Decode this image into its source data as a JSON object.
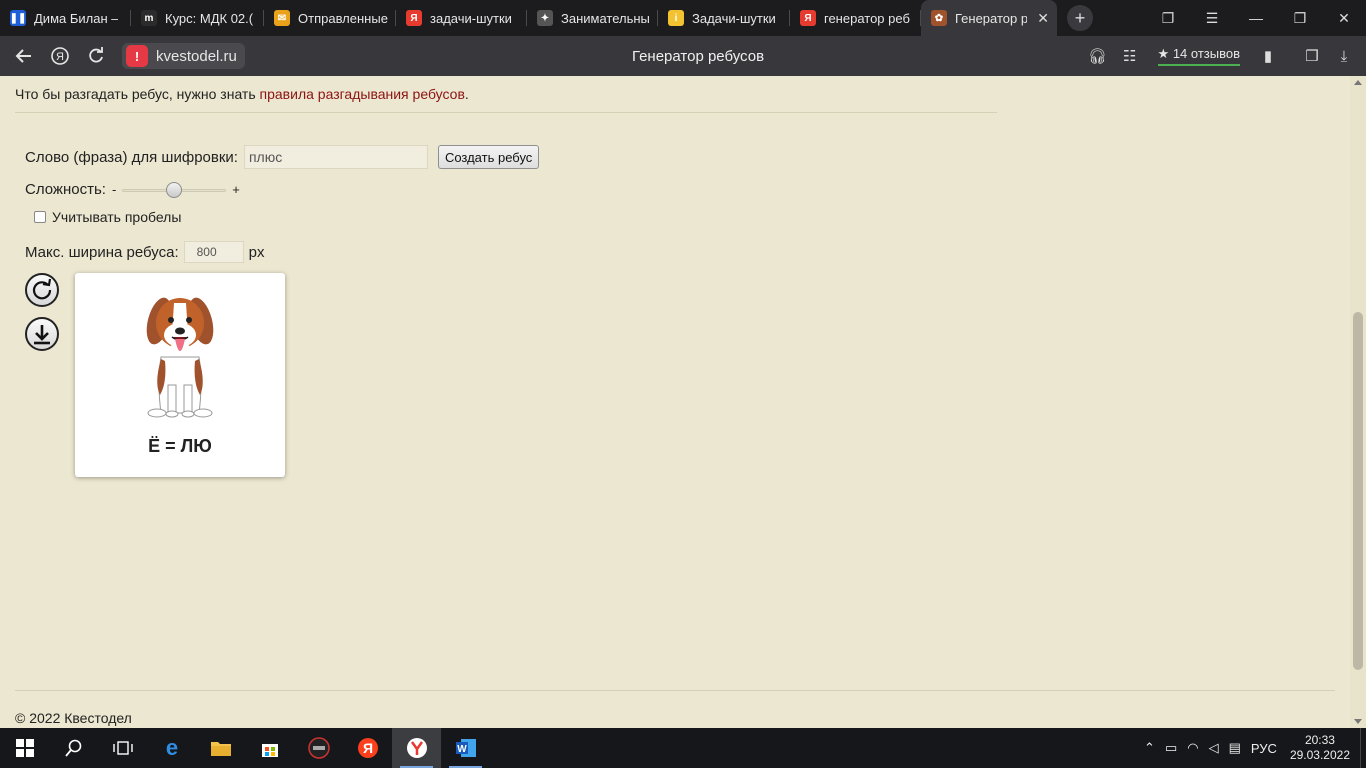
{
  "browser": {
    "tabs": [
      {
        "label": "Дима Билан –",
        "color": "#1e5fd8",
        "glyph": "❚❚"
      },
      {
        "label": "Курс: МДК 02.(",
        "color": "#2b2b2b",
        "glyph": "m"
      },
      {
        "label": "Отправленные",
        "color": "#e9a21a",
        "glyph": "✉"
      },
      {
        "label": "задачи-шутки",
        "color": "#e63b2e",
        "glyph": "Я"
      },
      {
        "label": "Занимательны",
        "color": "#555555",
        "glyph": "✦"
      },
      {
        "label": "Задачи-шутки",
        "color": "#f2c230",
        "glyph": "i"
      },
      {
        "label": "генератор реб",
        "color": "#e63b2e",
        "glyph": "Я"
      },
      {
        "label": "Генератор р",
        "color": "#a0522d",
        "glyph": "✿"
      }
    ],
    "active_tab_index": 7,
    "url": "kvestodel.ru",
    "page_title": "Генератор ребусов",
    "reviews_label": "14 отзывов"
  },
  "page": {
    "rules_prefix": "Что бы разгадать ребус, нужно знать ",
    "rules_link": "правила разгадывания ребусов",
    "rules_suffix": ".",
    "word_label": "Слово (фраза) для шифровки:",
    "word_value": "плюс",
    "create_button": "Создать ребус",
    "difficulty_label": "Сложность:",
    "difficulty_minus": "-",
    "difficulty_plus": "+",
    "difficulty_level": 0.5,
    "spaces_label": "Учитывать пробелы",
    "spaces_checked": false,
    "width_label": "Макс. ширина ребуса:",
    "width_value": "800",
    "width_unit": "px",
    "rebus_text": "Ё = ЛЮ",
    "rebus_image": "beagle-dog",
    "footer": "© 2022 Квестодел"
  },
  "taskbar": {
    "lang": "РУС",
    "time": "20:33",
    "date": "29.03.2022"
  }
}
